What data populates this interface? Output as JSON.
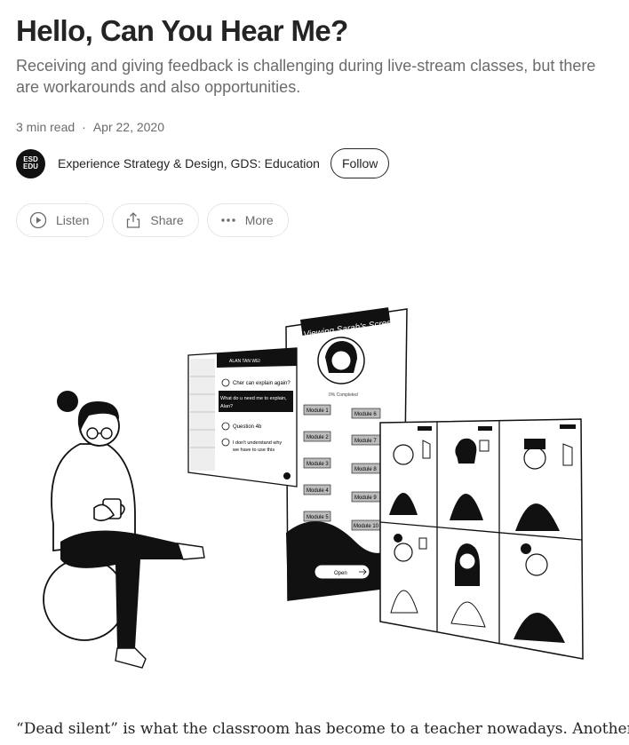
{
  "article": {
    "title": "Hello, Can You Hear Me?",
    "subtitle": "Receiving and giving feedback is challenging during live-stream classes, but there are workarounds and also opportunities.",
    "read_time": "3 min read",
    "separator": "·",
    "date": "Apr 22, 2020",
    "author": {
      "avatar_line1": "ESD",
      "avatar_line2": "EDU",
      "name": "Experience Strategy & Design, GDS: Education",
      "follow_label": "Follow"
    },
    "actions": {
      "listen": "Listen",
      "share": "Share",
      "more": "More"
    },
    "hero": {
      "screen_banner": "Viewing Sarah's Screen",
      "progress_text": "0% Completed",
      "modules_left": [
        "Module 1",
        "Module 2",
        "Module 3",
        "Module 4",
        "Module 5"
      ],
      "modules_right": [
        "Module 6",
        "Module 7",
        "Module 8",
        "Module 9",
        "Module 10"
      ],
      "open_button": "Open",
      "chat_header": "ALAN TAN WEI",
      "chat_msg1": "Cher can explain again?",
      "chat_reply1": "What do u need me to explain,",
      "chat_reply2": "Alan?",
      "chat_msg2": "Question 4b",
      "chat_msg3a": "I don't understand why",
      "chat_msg3b": "we have to use this"
    },
    "body_start": "“Dead silent” is what the classroom has become to a teacher nowadays. Another"
  },
  "colors": {
    "text": "#242424",
    "muted": "#6b6b6b",
    "border": "#e6e6e6"
  }
}
